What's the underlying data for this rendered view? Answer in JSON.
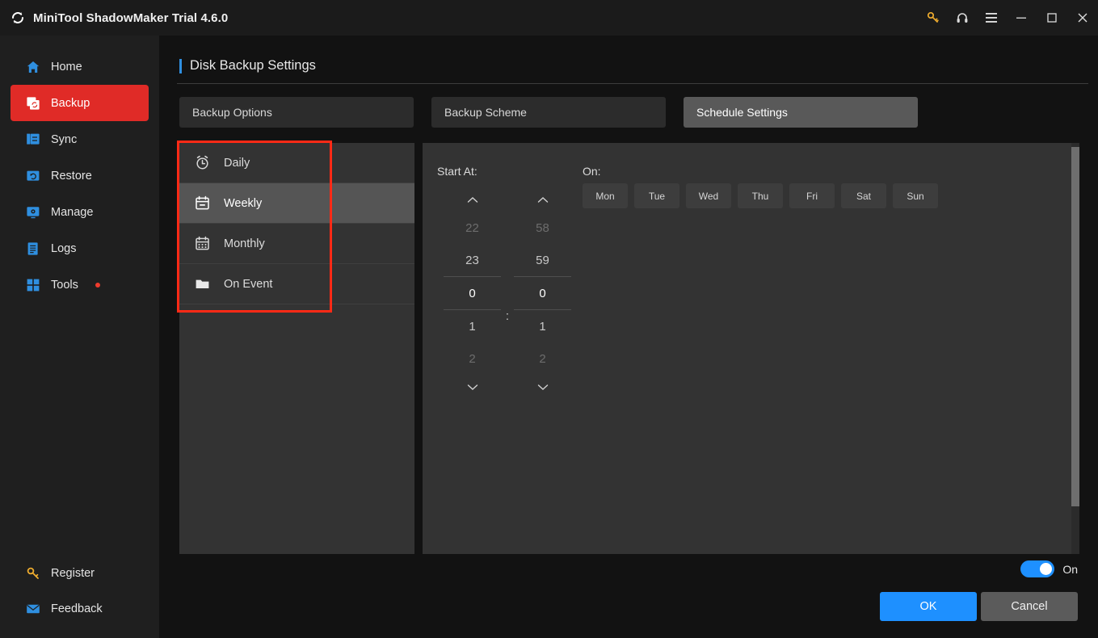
{
  "titlebar": {
    "app_title": "MiniTool ShadowMaker Trial 4.6.0",
    "logo_icon": "refresh-sync-logo",
    "buttons": [
      {
        "name": "key-icon",
        "label": "",
        "color": "#f0ad2e"
      },
      {
        "name": "headset-icon",
        "label": ""
      },
      {
        "name": "menu-icon",
        "label": ""
      },
      {
        "name": "minimize-icon",
        "label": ""
      },
      {
        "name": "maximize-icon",
        "label": ""
      },
      {
        "name": "close-icon",
        "label": ""
      }
    ]
  },
  "sidebar": {
    "items": [
      {
        "label": "Home",
        "icon": "home-icon",
        "active": false
      },
      {
        "label": "Backup",
        "icon": "backup-icon",
        "active": true
      },
      {
        "label": "Sync",
        "icon": "sync-icon",
        "active": false
      },
      {
        "label": "Restore",
        "icon": "restore-icon",
        "active": false
      },
      {
        "label": "Manage",
        "icon": "manage-icon",
        "active": false
      },
      {
        "label": "Logs",
        "icon": "logs-icon",
        "active": false
      },
      {
        "label": "Tools",
        "icon": "tools-icon",
        "active": false,
        "badge": true
      }
    ],
    "bottom_items": [
      {
        "label": "Register",
        "icon": "key-icon"
      },
      {
        "label": "Feedback",
        "icon": "envelope-icon"
      }
    ]
  },
  "main": {
    "page_title": "Disk Backup Settings",
    "tabs": [
      {
        "label": "Backup Options",
        "active": false
      },
      {
        "label": "Backup Scheme",
        "active": false
      },
      {
        "label": "Schedule Settings",
        "active": true
      }
    ],
    "schedule_types": [
      {
        "label": "Daily",
        "icon": "alarm-clock-icon",
        "selected": false
      },
      {
        "label": "Weekly",
        "icon": "calendar-week-icon",
        "selected": true
      },
      {
        "label": "Monthly",
        "icon": "calendar-month-icon",
        "selected": false
      },
      {
        "label": "On Event",
        "icon": "folder-icon",
        "selected": false
      }
    ],
    "start_at_label": "Start At:",
    "on_label": "On:",
    "time_picker": {
      "hours": [
        "22",
        "23",
        "0",
        "1",
        "2"
      ],
      "minutes": [
        "58",
        "59",
        "0",
        "1",
        "2"
      ],
      "selected_hour": "0",
      "selected_minute": "0",
      "separator": ":",
      "up_arrow_icon": "chevron-up-icon",
      "down_arrow_icon": "chevron-down-icon"
    },
    "days": [
      {
        "label": "Mon",
        "selected": false
      },
      {
        "label": "Tue",
        "selected": false
      },
      {
        "label": "Wed",
        "selected": false
      },
      {
        "label": "Thu",
        "selected": false
      },
      {
        "label": "Fri",
        "selected": false
      },
      {
        "label": "Sat",
        "selected": false
      },
      {
        "label": "Sun",
        "selected": false
      }
    ]
  },
  "footer": {
    "toggle_label": "On",
    "toggle_on": true,
    "ok_label": "OK",
    "cancel_label": "Cancel"
  },
  "colors": {
    "accent_blue": "#1e90ff",
    "accent_red": "#e02b27",
    "annotation_red": "#ff2a16",
    "icon_blue": "#2f8fe0",
    "key_orange": "#f0ad2e"
  }
}
